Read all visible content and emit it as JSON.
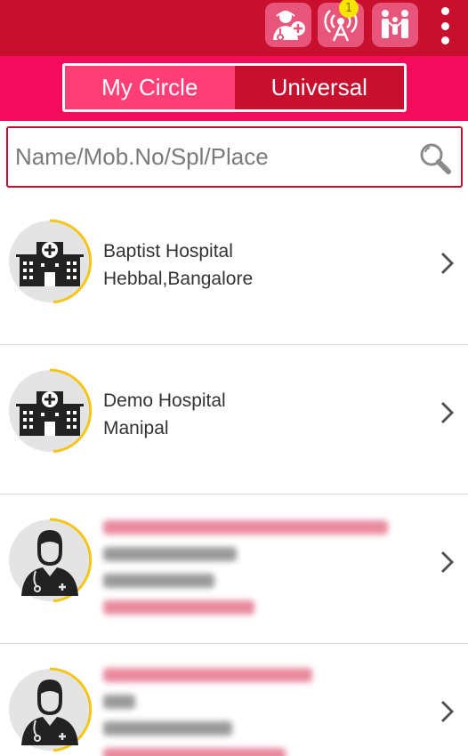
{
  "topbar": {
    "icons": [
      "add-doctor-icon",
      "broadcast-icon",
      "family-icon",
      "more-menu-icon"
    ],
    "notification_count": "1",
    "color": "#c8102e"
  },
  "tabs": {
    "my_circle": "My Circle",
    "universal": "Universal",
    "active": "Universal"
  },
  "search": {
    "placeholder": "Name/Mob.No/Spl/Place"
  },
  "list": [
    {
      "type": "hospital",
      "name": "Baptist Hospital",
      "place": "Hebbal,Bangalore"
    },
    {
      "type": "hospital",
      "name": "Demo Hospital",
      "place": "Manipal"
    },
    {
      "type": "doctor",
      "blurred": true
    },
    {
      "type": "doctor",
      "blurred": true
    }
  ],
  "colors": {
    "accent": "#f40b5c",
    "ring": "#f5c518",
    "avatar_bg": "#e4e4e4"
  }
}
